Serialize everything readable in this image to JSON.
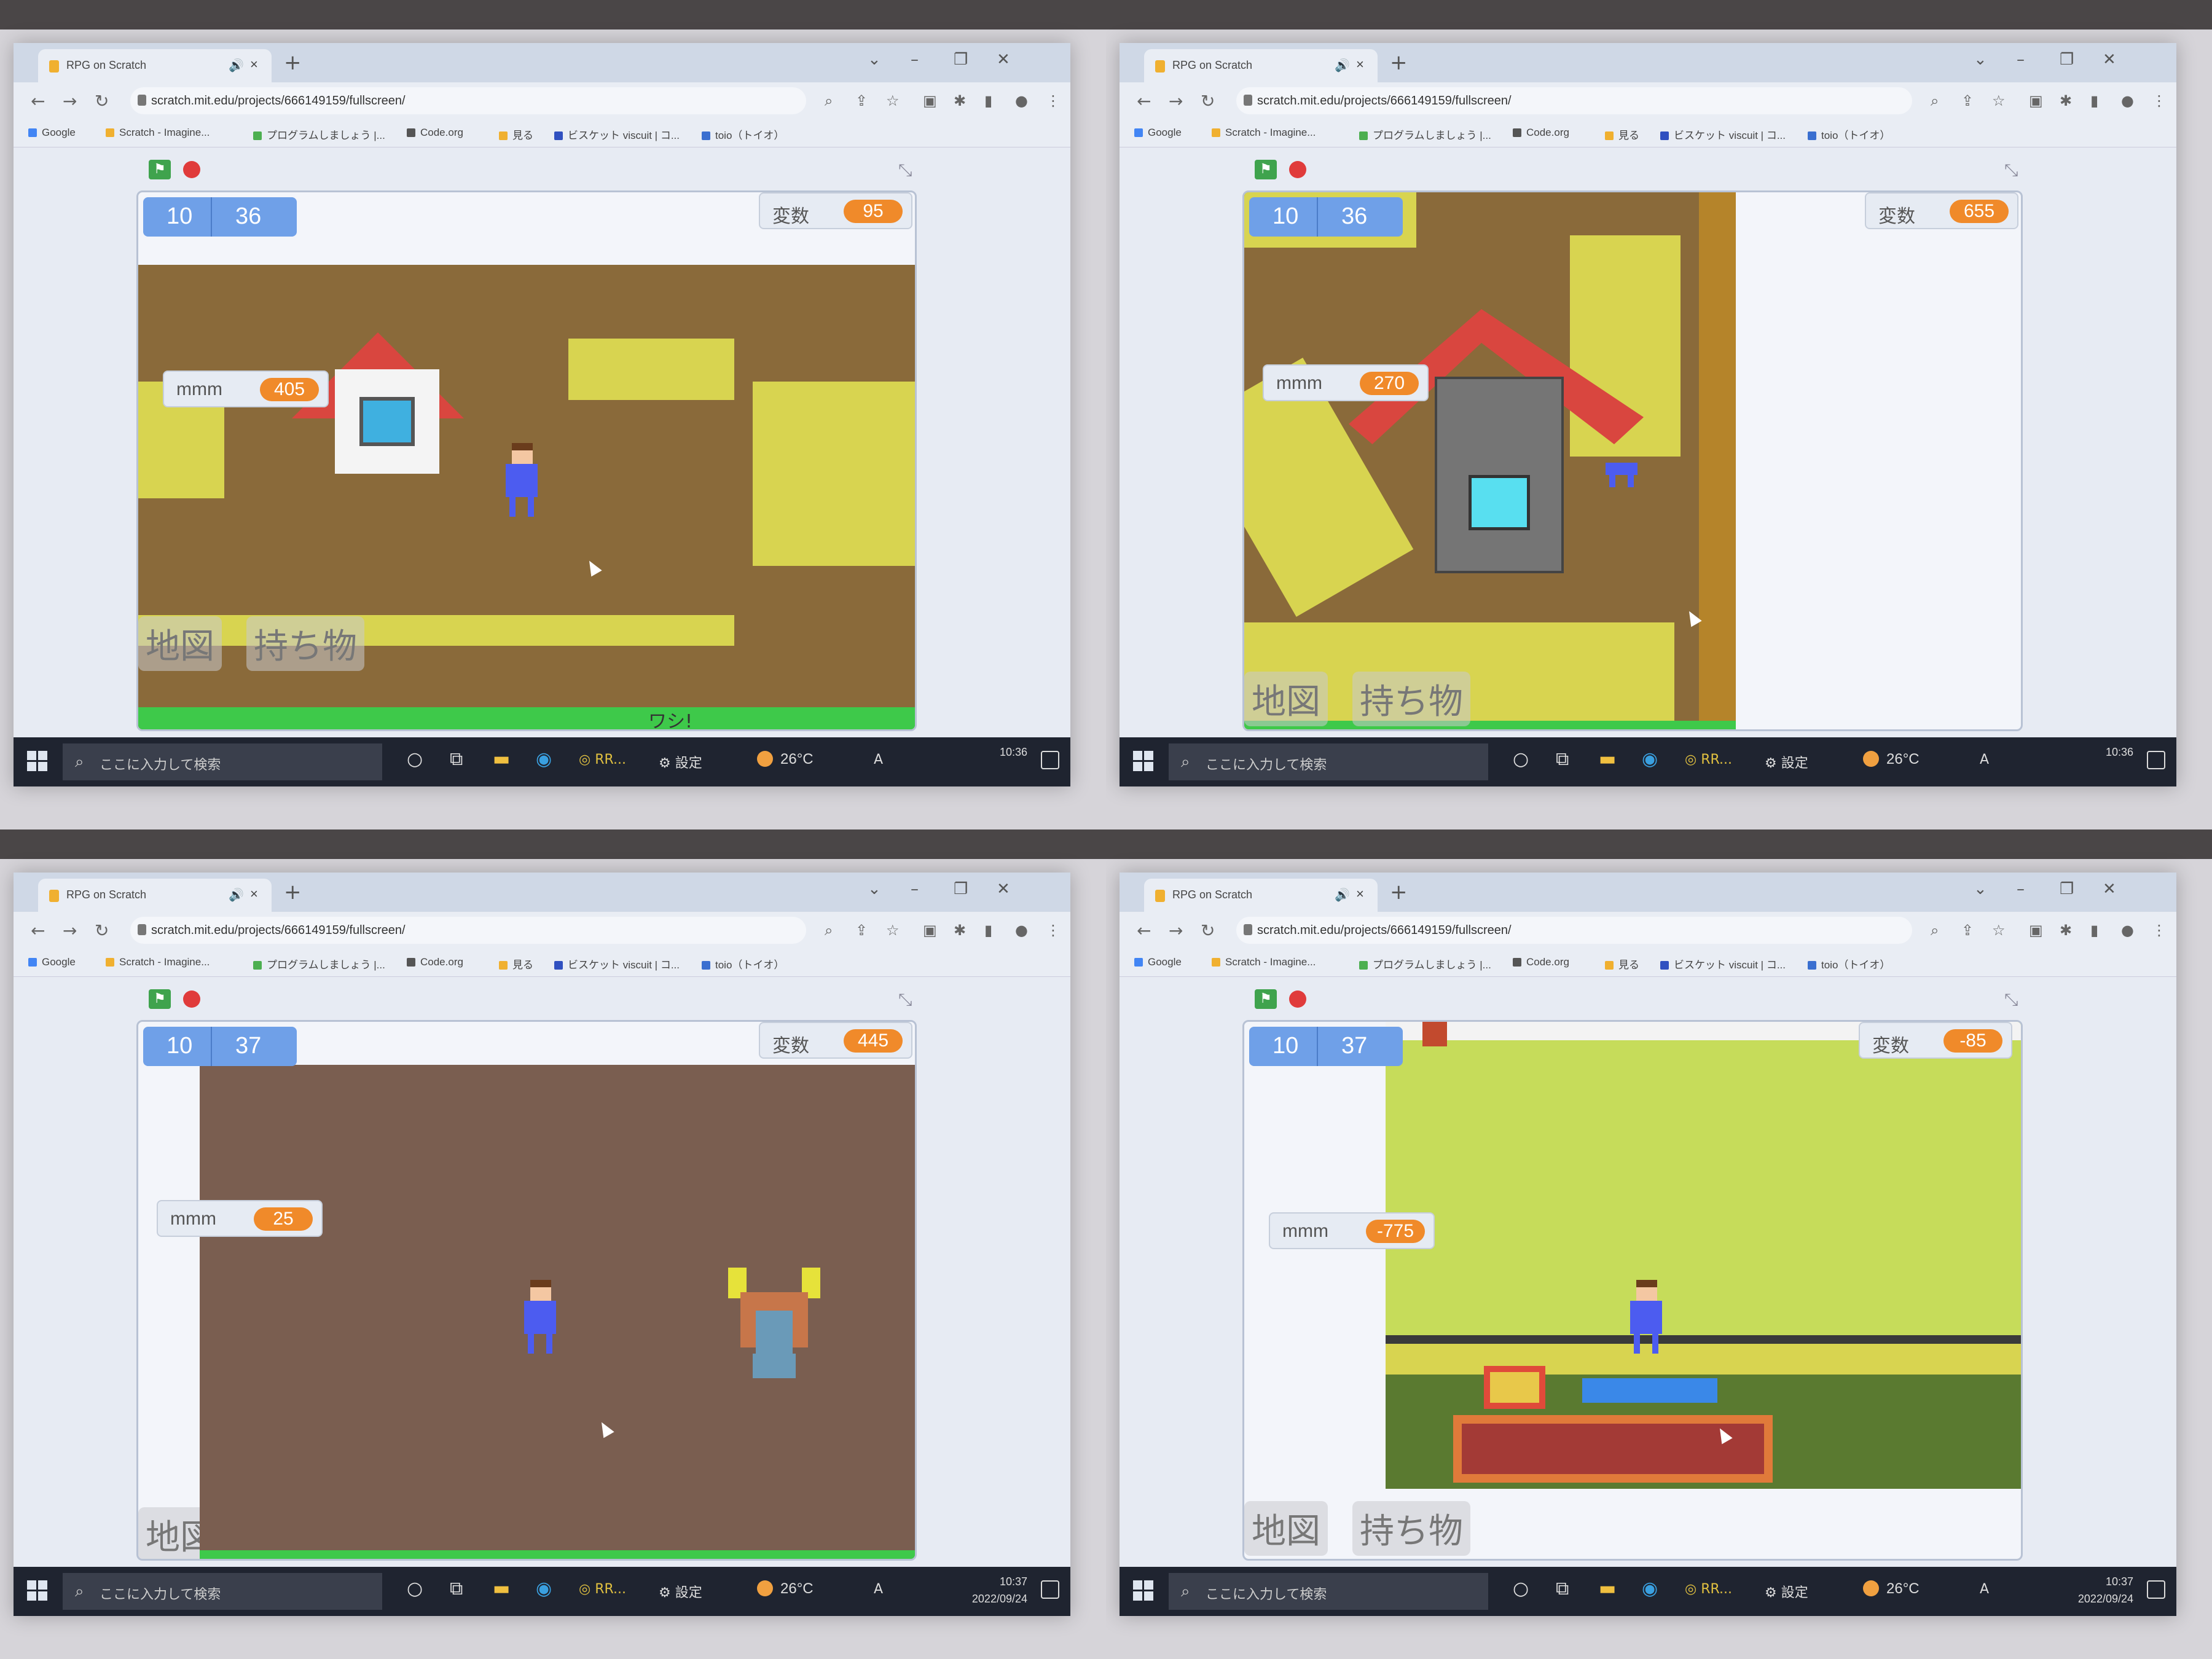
{
  "browser": {
    "tab_title": "RPG on Scratch",
    "url": "scratch.mit.edu/projects/666149159/fullscreen/",
    "bookmarks": [
      "Google",
      "Scratch - Imagine...",
      "プログラムしましょう |...",
      "Code.org",
      "見る",
      "ビスケット viscuit | コ...",
      "toio（トイオ）"
    ]
  },
  "scratch": {
    "var_label": "変数",
    "mmm_label": "mmm",
    "map_button": "地図",
    "items_button": "持ち物"
  },
  "taskbar": {
    "search_placeholder": "ここに入力して検索",
    "settings_label": "設定",
    "app_label": "RR...",
    "temperature": "26°C",
    "ime": "A"
  },
  "panels": [
    {
      "level_a": "10",
      "level_b": "36",
      "var_value": "95",
      "mmm_value": "405",
      "sign_text": "ワシ!",
      "time": "10:36",
      "date": ""
    },
    {
      "level_a": "10",
      "level_b": "36",
      "var_value": "655",
      "mmm_value": "270",
      "time": "10:36",
      "date": ""
    },
    {
      "level_a": "10",
      "level_b": "37",
      "var_value": "445",
      "mmm_value": "25",
      "time": "10:37",
      "date": "2022/09/24"
    },
    {
      "level_a": "10",
      "level_b": "37",
      "var_value": "-85",
      "mmm_value": "-775",
      "time": "10:37",
      "date": "2022/09/24"
    }
  ],
  "colors": {
    "ground_brown": "#8a6a3a",
    "house_roof": "#d9463f",
    "path_yellow": "#d8d450",
    "grass_green": "#c6dc5a",
    "variable_orange": "#f08a2a",
    "level_blue": "#6fa0e8",
    "hero_blue": "#4c5cf0"
  }
}
